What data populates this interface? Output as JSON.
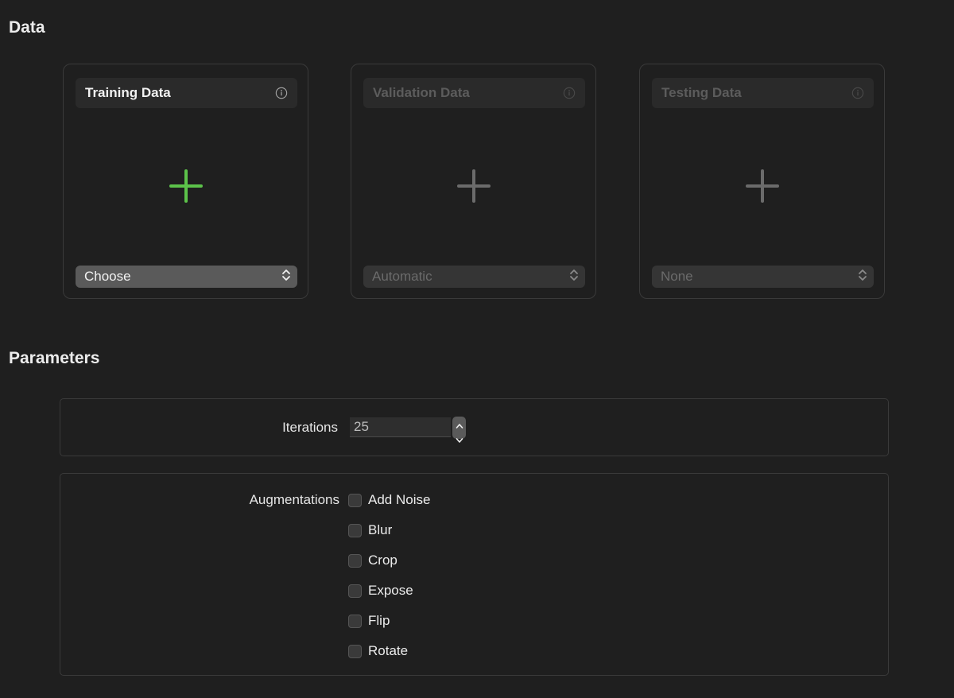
{
  "sections": {
    "data_title": "Data",
    "parameters_title": "Parameters"
  },
  "cards": [
    {
      "title": "Training Data",
      "popup_value": "Choose",
      "enabled": true,
      "accent": "#5cc24a"
    },
    {
      "title": "Validation Data",
      "popup_value": "Automatic",
      "enabled": false,
      "accent": "#6b6b6b"
    },
    {
      "title": "Testing Data",
      "popup_value": "None",
      "enabled": false,
      "accent": "#6b6b6b"
    }
  ],
  "icons": {
    "info": "info-circle-icon",
    "add": "plus-icon",
    "popup": "up-down-chevron-icon",
    "stepper": "stepper-arrows-icon"
  },
  "iterations": {
    "label": "Iterations",
    "value": "25"
  },
  "augmentations": {
    "label": "Augmentations",
    "options": [
      {
        "label": "Add Noise",
        "checked": false
      },
      {
        "label": "Blur",
        "checked": false
      },
      {
        "label": "Crop",
        "checked": false
      },
      {
        "label": "Expose",
        "checked": false
      },
      {
        "label": "Flip",
        "checked": false
      },
      {
        "label": "Rotate",
        "checked": false
      }
    ]
  },
  "colors": {
    "background": "#1f1f1f",
    "accent_green": "#5cc24a",
    "border": "#3a3a3a"
  }
}
